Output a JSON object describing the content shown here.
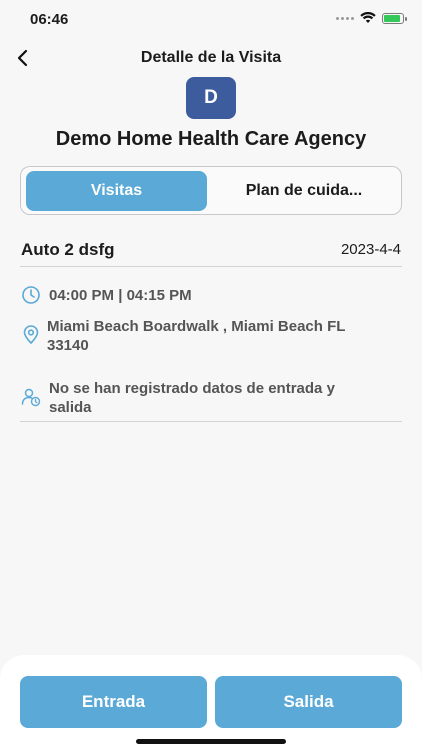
{
  "status_bar": {
    "time": "06:46",
    "battery_level": 0.8
  },
  "header": {
    "title": "Detalle de la Visita",
    "back_icon": "chevron-left-icon"
  },
  "agency": {
    "logo_letter": "D",
    "name": "Demo Home Health Care Agency",
    "logo_color": "#3d5c9e"
  },
  "tabs": [
    {
      "label": "Visitas",
      "active": true
    },
    {
      "label": "Plan de cuida...",
      "active": false
    }
  ],
  "visit": {
    "name": "Auto 2 dsfg",
    "date": "2023-4-4",
    "time_range": "04:00 PM | 04:15 PM",
    "address": "Miami Beach Boardwalk , Miami Beach FL 33140",
    "checkin_status": "No se han registrado datos de entrada y salida"
  },
  "actions": {
    "entrada_label": "Entrada",
    "salida_label": "Salida"
  },
  "colors": {
    "accent": "#5aa9d6",
    "background": "#f7f7f7"
  }
}
